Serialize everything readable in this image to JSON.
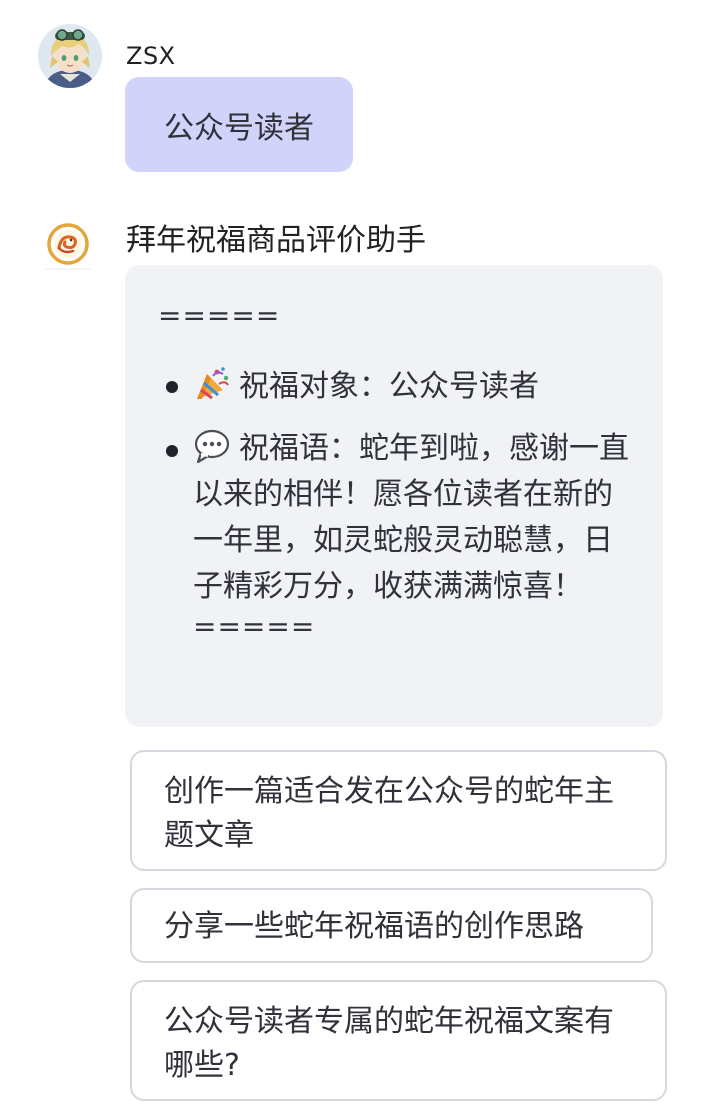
{
  "user": {
    "name": "ZSX",
    "message": "公众号读者"
  },
  "bot": {
    "name": "拜年祝福商品评价助手",
    "separator_top": "=====",
    "items": [
      {
        "emoji": "party-popper-icon",
        "text": "祝福对象：公众号读者"
      },
      {
        "emoji": "speech-bubble-icon",
        "text": "祝福语：蛇年到啦，感谢一直以来的相伴！愿各位读者在新的一年里，如灵蛇般灵动聪慧，日子精彩万分，收获满满惊喜！"
      }
    ],
    "separator_bottom": "====="
  },
  "suggestions": [
    "创作一篇适合发在公众号的蛇年主题文章",
    "分享一些蛇年祝福语的创作思路",
    "公众号读者专属的蛇年祝福文案有哪些?"
  ],
  "colors": {
    "user_bubble": "#d2d3fa",
    "bot_bubble": "#f1f2f6",
    "suggestion_border": "#d5d8de"
  }
}
